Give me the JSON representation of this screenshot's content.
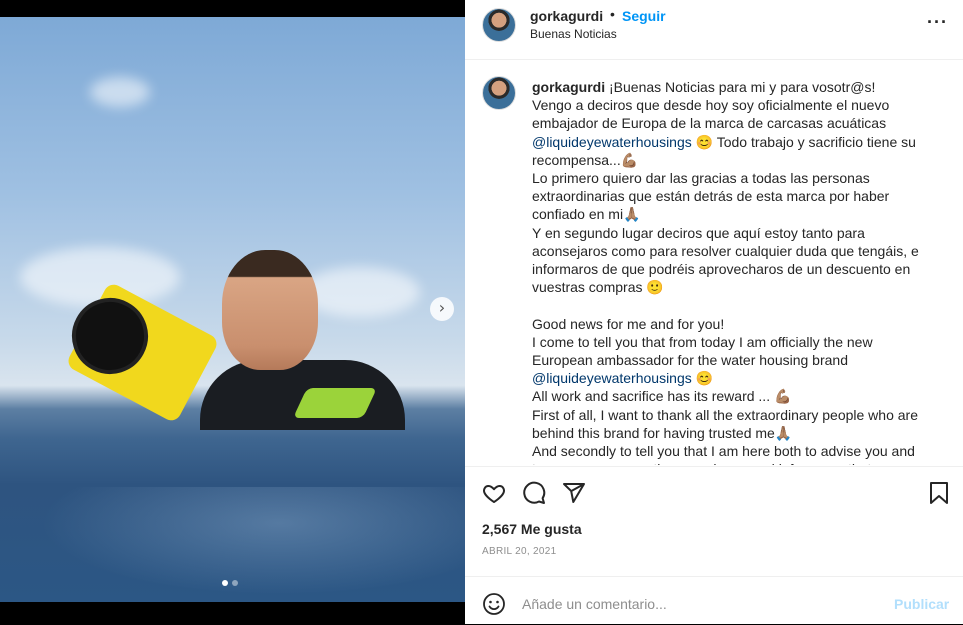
{
  "post": {
    "username": "gorkagurdi",
    "follow_label": "Seguir",
    "location": "Buenas Noticias",
    "caption_user": "gorkagurdi",
    "caption_part1": " ¡Buenas Noticias para mi y para vosotr@s!\nVengo a deciros que desde hoy soy oficialmente el nuevo\nembajador de Europa de la marca de carcasas acuáticas\n",
    "mention1": "@liquideyewaterhousings",
    "caption_part2": " 😊 Todo trabajo y sacrificio tiene su\nrecompensa...💪🏽\nLo primero quiero dar las gracias a todas las personas\nextraordinarias que están detrás de esta marca por haber\nconfiado en mi🙏🏽\nY en segundo lugar deciros que aquí estoy tanto para\naconsejaros como para resolver cualquier duda que tengáis, e\ninformaros de que podréis aprovecharos de un descuento en\nvuestras compras 🙂\n\nGood news for me and for you!\nI come to tell you that from today I am officially the new\nEuropean ambassador for the water housing brand\n",
    "mention2": "@liquideyewaterhousings",
    "caption_part3": " 😊\nAll work and sacrifice has its reward ... 💪🏽\nFirst of all, I want to thank all the extraordinary people who are\nbehind this brand for having trusted me🙏🏽\nAnd secondly to tell you that I am here both to advise you and\nto answer any questions you have, and inform you that you",
    "likes": "2,567 Me gusta",
    "date": "ABRIL 20, 2021",
    "comment_placeholder": "Añade un comentario...",
    "publish_label": "Publicar",
    "carousel_index": 1,
    "carousel_total": 2
  },
  "icons": {
    "more": "more-options-icon",
    "like": "heart-icon",
    "comment": "comment-icon",
    "share": "share-icon",
    "save": "bookmark-icon",
    "emoji": "emoji-icon",
    "next": "chevron-right-icon"
  },
  "colors": {
    "follow": "#0095f6",
    "publish_disabled": "#b2dffc",
    "mention": "#00376b"
  }
}
